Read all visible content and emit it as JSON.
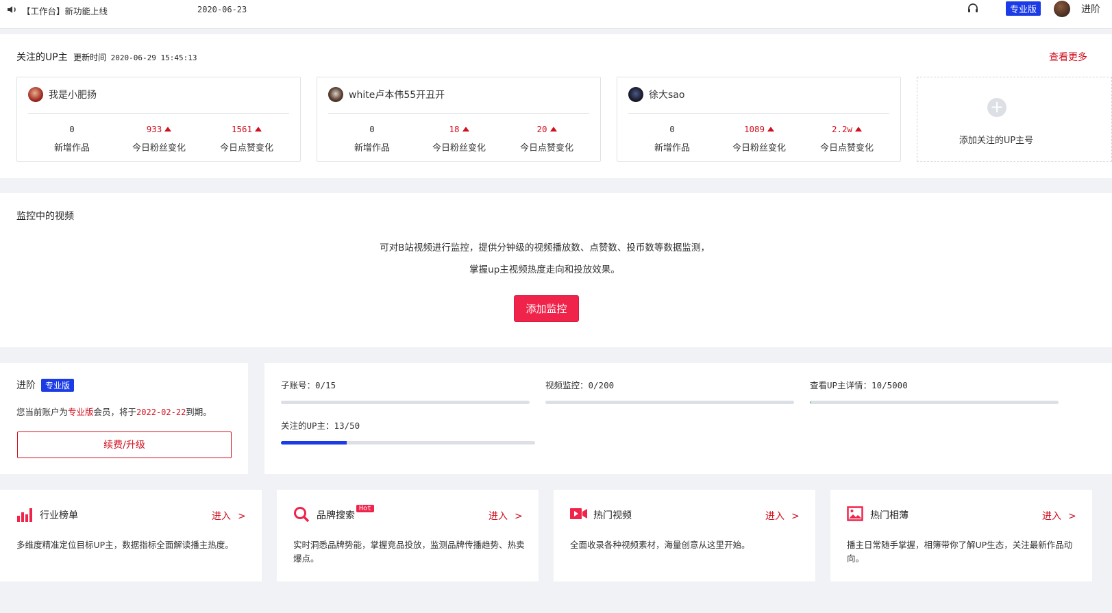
{
  "topbar": {
    "notice": "【工作台】新功能上线",
    "notice_date": "2020-06-23",
    "pro_badge": "专业版",
    "user_name": "进阶"
  },
  "follow": {
    "title": "关注的UP主",
    "update_label": "更新时间",
    "update_time": "2020-06-29 15:45:13",
    "more_link": "查看更多",
    "cards": [
      {
        "name": "我是小肥扬",
        "new_works": "0",
        "fans_change": "933",
        "likes_change": "1561"
      },
      {
        "name": "white卢本伟55开丑开",
        "new_works": "0",
        "fans_change": "18",
        "likes_change": "20"
      },
      {
        "name": "徐大sao",
        "new_works": "0",
        "fans_change": "1089",
        "likes_change": "2.2w"
      }
    ],
    "stat_labels": {
      "new_works": "新增作品",
      "fans": "今日粉丝变化",
      "likes": "今日点赞变化"
    },
    "add_label": "添加关注的UP主号"
  },
  "monitor": {
    "title": "监控中的视频",
    "line1": "可对B站视频进行监控，提供分钟级的视频播放数、点赞数、投币数等数据监测，",
    "line2": "掌握up主视频热度走向和投放效果。",
    "button": "添加监控"
  },
  "membership": {
    "level": "进阶",
    "badge": "专业版",
    "text_prefix": "您当前账户为",
    "plan": "专业版",
    "text_mid": "会员，将于",
    "expire_date": "2022-02-22",
    "text_suffix": "到期。",
    "renew_button": "续费/升级"
  },
  "quota": [
    {
      "label": "子账号：0/15",
      "fraction": 0.0
    },
    {
      "label": "视频监控：0/200",
      "fraction": 0.0
    },
    {
      "label": "查看UP主详情：10/5000",
      "fraction": 0.002
    },
    {
      "label": "关注的UP主：13/50",
      "fraction": 0.26
    }
  ],
  "features": [
    {
      "icon": "bar-chart-icon",
      "title": "行业榜单",
      "enter": "进入",
      "desc": "多维度精准定位目标UP主，数据指标全面解读播主热度。"
    },
    {
      "icon": "search-icon",
      "title": "品牌搜索",
      "hot": "Hot",
      "enter": "进入",
      "desc": "实时洞悉品牌势能，掌握竞品投放，监测品牌传播趋势、热卖爆点。"
    },
    {
      "icon": "video-icon",
      "title": "热门视频",
      "enter": "进入",
      "desc": "全面收录各种视频素材，海量创意从这里开始。"
    },
    {
      "icon": "image-icon",
      "title": "热门相薄",
      "enter": "进入",
      "desc": "播主日常随手掌握，相簿带你了解UP生态，关注最新作品动向。"
    }
  ],
  "colors": {
    "accent": "#d0101e",
    "button": "#f0244b",
    "pro": "#1a3be6"
  }
}
